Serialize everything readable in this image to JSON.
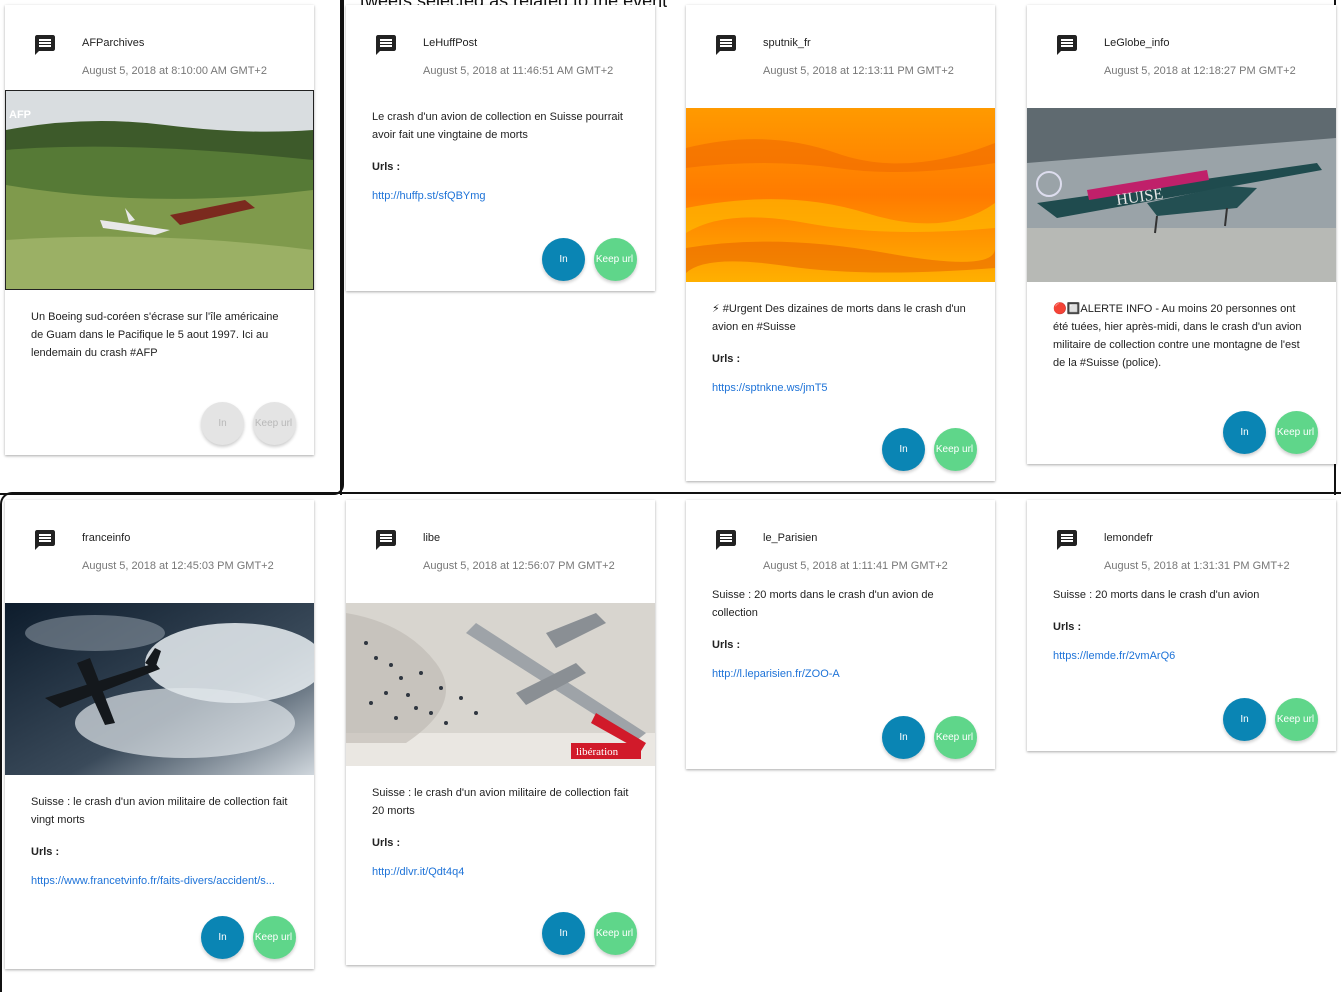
{
  "selection": {
    "label": "tweets selected as related to the event"
  },
  "buttons": {
    "in": "In",
    "keep": "Keep url"
  },
  "urls_label": "Urls :",
  "colors": {
    "in_button": "#0a85b4",
    "keep_button": "#5fd68a",
    "link": "#1e73d8",
    "selection_border": "#111111"
  },
  "tweets": [
    {
      "user": "AFParchives",
      "date": "August 5, 2018 at 8:10:00 AM GMT+2",
      "text": "Un Boeing sud-coréen s'écrase sur l'île américaine de Guam dans le Pacifique le 5 aout 1997. Ici au lendemain du crash #AFP",
      "image": "crash-hillside-photo",
      "url": ""
    },
    {
      "user": "LeHuffPost",
      "date": "August 5, 2018 at 11:46:51 AM GMT+2",
      "text": "Le crash d'un avion de collection en Suisse pourrait avoir fait une vingtaine de morts",
      "image": "",
      "url": "http://huffp.st/sfQBYmg"
    },
    {
      "user": "sputnik_fr",
      "date": "August 5, 2018 at 12:13:11 PM GMT+2",
      "text": "⚡ #Urgent Des dizaines de morts dans le crash d'un avion en #Suisse",
      "image": "fire-photo",
      "url": "https://sptnkne.ws/jmT5"
    },
    {
      "user": "LeGlobe_info",
      "date": "August 5, 2018 at 12:18:27 PM GMT+2",
      "text": "🔴🔲ALERTE INFO - Au moins 20 personnes ont été tuées, hier après-midi, dans le crash d'un avion militaire de collection contre une montagne de l'est de la #Suisse (police).",
      "image": "hangar-plane-photo",
      "image_caption": "HUISE",
      "url": ""
    },
    {
      "user": "franceinfo",
      "date": "August 5, 2018 at 12:45:03 PM GMT+2",
      "text": "Suisse : le crash d'un avion militaire de collection fait vingt morts",
      "image": "plane-in-clouds-photo",
      "url": "https://www.francetvinfo.fr/faits-divers/accident/s..."
    },
    {
      "user": "libe",
      "date": "August 5, 2018 at 12:56:07 PM GMT+2",
      "text": "Suisse : le crash d'un avion militaire de collection fait 20 morts",
      "image": "aerial-plane-crowd-photo",
      "image_caption": "libération",
      "url": "http://dlvr.it/Qdt4q4"
    },
    {
      "user": "le_Parisien",
      "date": "August 5, 2018 at 1:11:41 PM GMT+2",
      "text": "Suisse : 20 morts dans le crash d'un avion de collection",
      "image": "",
      "url": "http://l.leparisien.fr/ZOO-A"
    },
    {
      "user": "lemondefr",
      "date": "August 5, 2018 at 1:31:31 PM GMT+2",
      "text": "Suisse : 20 morts dans le crash d'un avion",
      "image": "",
      "url": "https://lemde.fr/2vmArQ6"
    }
  ]
}
